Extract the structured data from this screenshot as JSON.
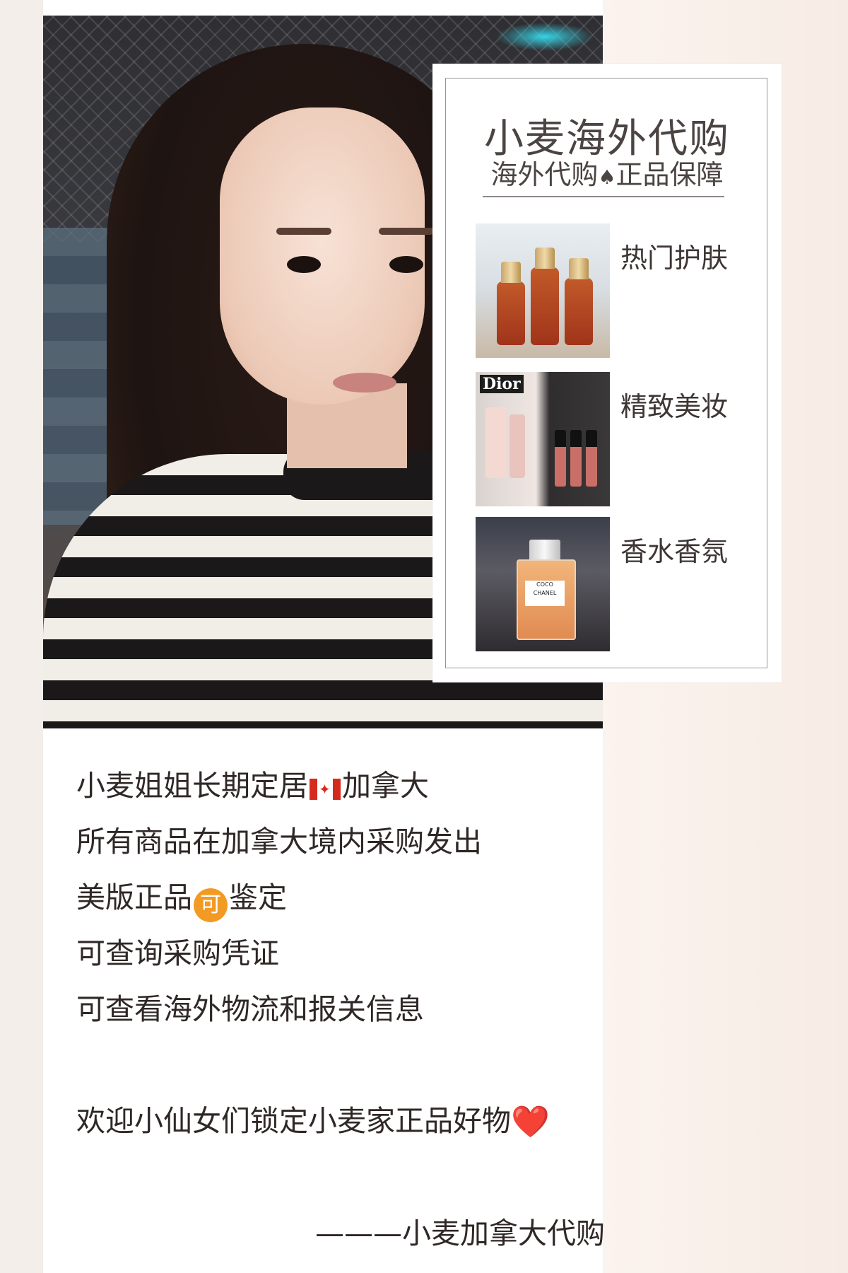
{
  "brand": {
    "title": "小麦海外代购",
    "subtitle_a": "海外代购",
    "subtitle_sep": "♠",
    "subtitle_b": "正品保障"
  },
  "categories": [
    {
      "label": "热门护肤",
      "icon": "skincare-bottles-photo"
    },
    {
      "label": "精致美妆",
      "icon": "dior-makeup-photo",
      "badge": "Dior"
    },
    {
      "label": "香水香氛",
      "icon": "chanel-perfume-photo",
      "bottle_text": [
        "COCO",
        "CHANEL"
      ]
    }
  ],
  "intro": {
    "line1_a": "小麦姐姐长期定居",
    "line1_b": "加拿大",
    "line2": "所有商品在加拿大境内采购发出",
    "line3_a": "美版正品",
    "line3_badge": "可",
    "line3_b": "鉴定",
    "line4": "可查询采购凭证",
    "line5": "可查看海外物流和报关信息",
    "line6": "欢迎小仙女们锁定小麦家正品好物",
    "heart": "❤️"
  },
  "signature": "———小麦加拿大代购",
  "colors": {
    "background": "#f8efe9",
    "text": "#2f2826",
    "badge_orange": "#f39a24",
    "heart_red": "#e11d2f"
  }
}
